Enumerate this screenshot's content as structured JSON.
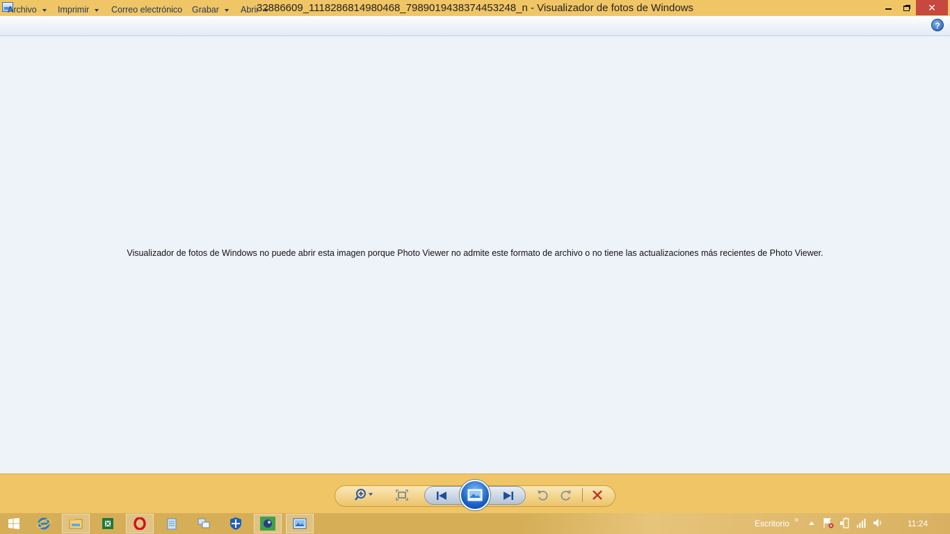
{
  "window": {
    "title": "32886609_1118286814980468_7989019438374453248_n - Visualizador de fotos de Windows",
    "close_glyph": "✕"
  },
  "menu": {
    "archivo": "Archivo",
    "imprimir": "Imprimir",
    "correo": "Correo electrónico",
    "grabar": "Grabar",
    "abrir": "Abrir",
    "help_glyph": "?"
  },
  "content": {
    "message": "Visualizador de fotos de Windows no puede abrir esta imagen porque Photo Viewer no admite este formato de archivo o no tiene las actualizaciones más recientes de Photo Viewer."
  },
  "controls": {
    "icons": [
      "zoom-icon",
      "fit-window-icon",
      "previous-icon",
      "slideshow-icon",
      "next-icon",
      "rotate-left-icon",
      "rotate-right-icon",
      "delete-icon"
    ]
  },
  "taskbar": {
    "apps": [
      "start-icon",
      "internet-explorer-icon",
      "file-explorer-icon",
      "excel-icon",
      "opera-icon",
      "notepad-icon",
      "network-icon",
      "defender-icon",
      "game-icon",
      "photo-viewer-icon"
    ],
    "desktop_label": "Escritorio",
    "chevron": "»",
    "clock": "11:24"
  },
  "colors": {
    "accent": "#f0c566",
    "taskbar": "#d6ae58",
    "close_button": "#c7483f",
    "content_bg": "#eef2f9",
    "delete_red": "#c0302b"
  }
}
